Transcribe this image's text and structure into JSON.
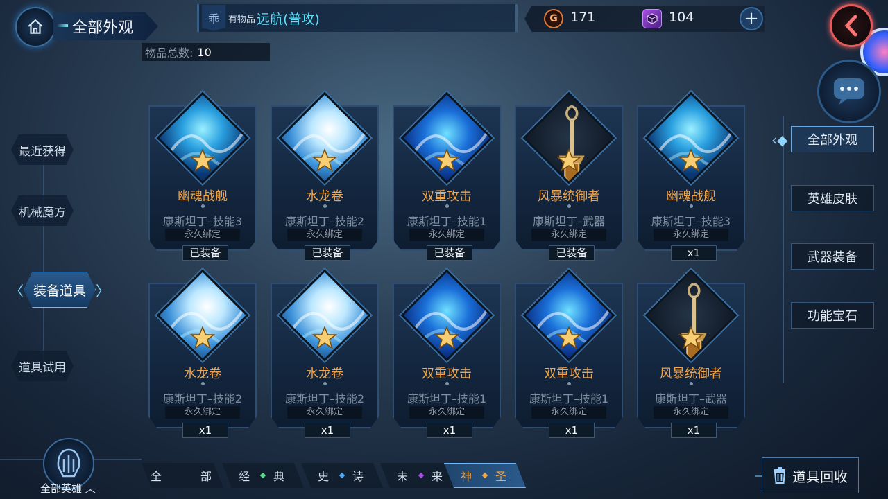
{
  "header": {
    "title": "全部外观",
    "total_label": "物品总数:",
    "total_value": "10"
  },
  "banner": {
    "badge": "乖",
    "prefix": "有物品",
    "name": "远航(普攻)"
  },
  "currency": {
    "gold_symbol": "G",
    "gold_value": "171",
    "gem_value": "104",
    "add": "+"
  },
  "left_nav": {
    "items": [
      {
        "label": "最近获得"
      },
      {
        "label": "机械魔方"
      },
      {
        "label": "装备道具"
      },
      {
        "label": "道具试用"
      }
    ],
    "active_index": 2
  },
  "right_tabs": {
    "items": [
      {
        "label": "全部外观"
      },
      {
        "label": "英雄皮肤"
      },
      {
        "label": "武器装备"
      },
      {
        "label": "功能宝石"
      }
    ],
    "active_index": 0
  },
  "cards": [
    {
      "icon": "ghost-ship",
      "name": "幽魂战舰",
      "desc": "康斯坦丁–技能3",
      "bind": "永久绑定",
      "status": "已装备"
    },
    {
      "icon": "tornado",
      "name": "水龙卷",
      "desc": "康斯坦丁–技能2",
      "bind": "永久绑定",
      "status": "已装备"
    },
    {
      "icon": "wave",
      "name": "双重攻击",
      "desc": "康斯坦丁–技能1",
      "bind": "永久绑定",
      "status": "已装备"
    },
    {
      "icon": "sword",
      "name": "风暴统御者",
      "desc": "康斯坦丁–武器",
      "bind": "永久绑定",
      "status": "已装备"
    },
    {
      "icon": "ghost-ship",
      "name": "幽魂战舰",
      "desc": "康斯坦丁–技能3",
      "bind": "永久绑定",
      "status": "x1"
    },
    {
      "icon": "tornado",
      "name": "水龙卷",
      "desc": "康斯坦丁–技能2",
      "bind": "永久绑定",
      "status": "x1"
    },
    {
      "icon": "tornado",
      "name": "水龙卷",
      "desc": "康斯坦丁–技能2",
      "bind": "永久绑定",
      "status": "x1"
    },
    {
      "icon": "wave",
      "name": "双重攻击",
      "desc": "康斯坦丁–技能1",
      "bind": "永久绑定",
      "status": "x1"
    },
    {
      "icon": "wave",
      "name": "双重攻击",
      "desc": "康斯坦丁–技能1",
      "bind": "永久绑定",
      "status": "x1"
    },
    {
      "icon": "sword",
      "name": "风暴统御者",
      "desc": "康斯坦丁–武器",
      "bind": "永久绑定",
      "status": "x1"
    }
  ],
  "filters": {
    "items": [
      {
        "left": "全",
        "right": "部",
        "dot_color": ""
      },
      {
        "left": "经",
        "right": "典",
        "dot_color": "#59d98a"
      },
      {
        "left": "史",
        "right": "诗",
        "dot_color": "#4fa6f0"
      },
      {
        "left": "未",
        "right": "来",
        "dot_color": "#a34fe0"
      },
      {
        "left": "神",
        "right": "圣",
        "dot_color": "#f0a64a"
      }
    ],
    "active_index": 4
  },
  "footer": {
    "hero_label": "全部英雄",
    "recycle_label": "道具回收"
  },
  "colors": {
    "accent_cyan": "#5fe6ff",
    "item_name_orange": "#f0a64a",
    "back_red": "#e55a5a"
  }
}
